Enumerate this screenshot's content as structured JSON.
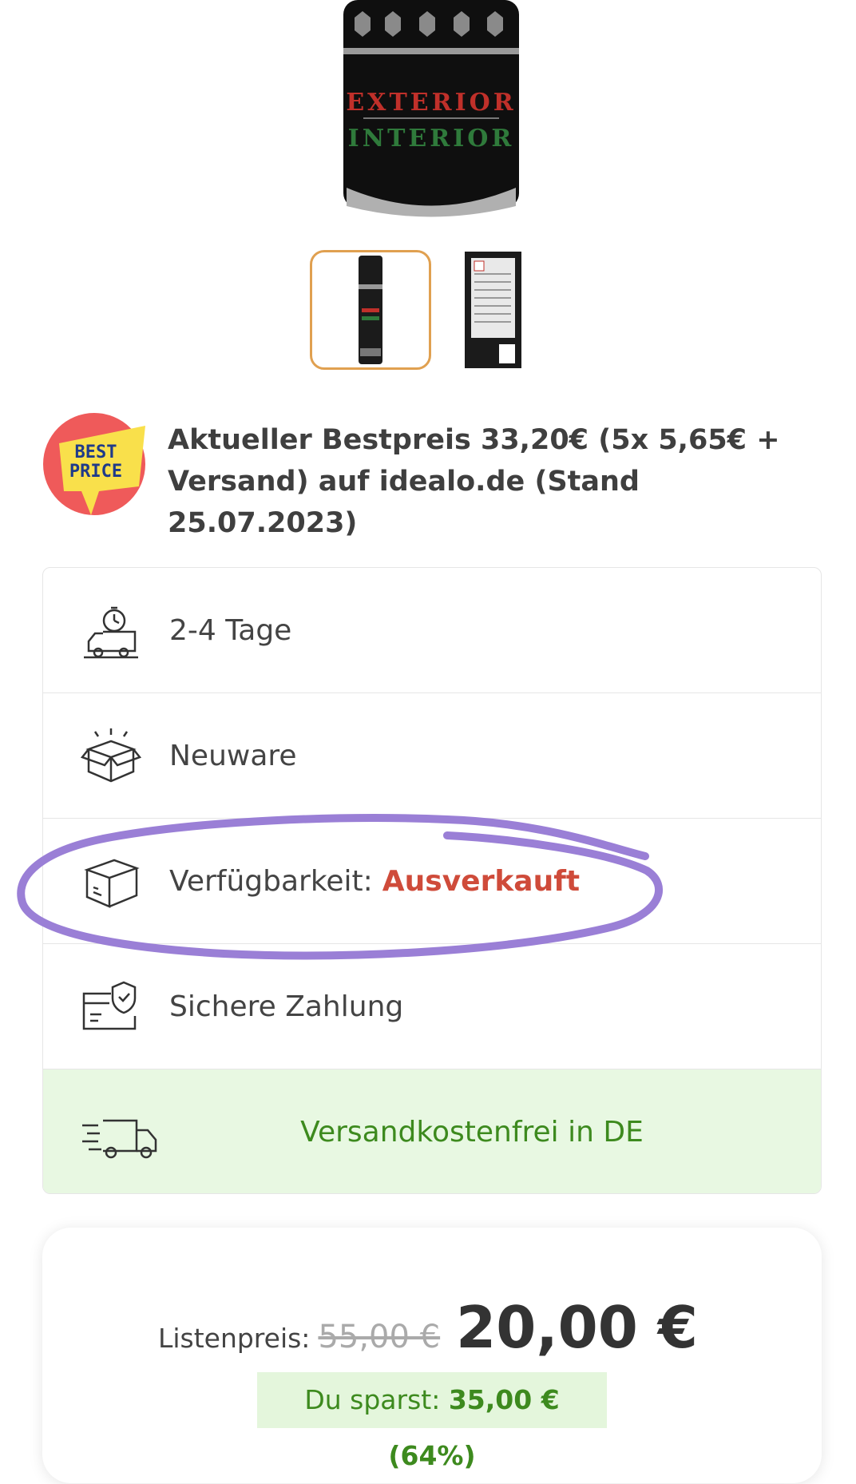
{
  "product": {
    "can_label_top": "EXTERIOR",
    "can_label_bottom": "INTERIOR",
    "thumbnails": [
      {
        "selected": true
      },
      {
        "selected": false
      }
    ]
  },
  "best_price": {
    "badge_line1": "BEST",
    "badge_line2": "PRICE",
    "text": "Aktueller Bestpreis 33,20€ (5x 5,65€ + Versand) auf idealo.de (Stand 25.07.2023)"
  },
  "features": {
    "shipping_time": "2-4 Tage",
    "condition": "Neuware",
    "availability_label": "Verfügbarkeit:",
    "availability_value": "Ausverkauft",
    "payment": "Sichere Zahlung",
    "free_shipping": "Versandkostenfrei in DE"
  },
  "price": {
    "list_label": "Listenpreis:",
    "list_price": "55,00 €",
    "current_price": "20,00 €",
    "savings_label": "Du sparst:",
    "savings_value": "35,00 € (64%)"
  },
  "colors": {
    "thumb_selected_border": "#e0a050",
    "availability_red": "#cf4b3a",
    "free_shipping_green": "#3d8a1e",
    "free_shipping_bg": "#e8f8e2",
    "annotation_purple": "#9a7fd6",
    "badge_red": "#ef5a5a",
    "badge_yellow": "#f9e04b"
  },
  "icons": {
    "shipping_time": "delivery-truck-clock-icon",
    "condition": "new-box-icon",
    "availability": "package-box-icon",
    "payment": "secure-payment-icon",
    "free_shipping": "fast-delivery-truck-icon"
  }
}
